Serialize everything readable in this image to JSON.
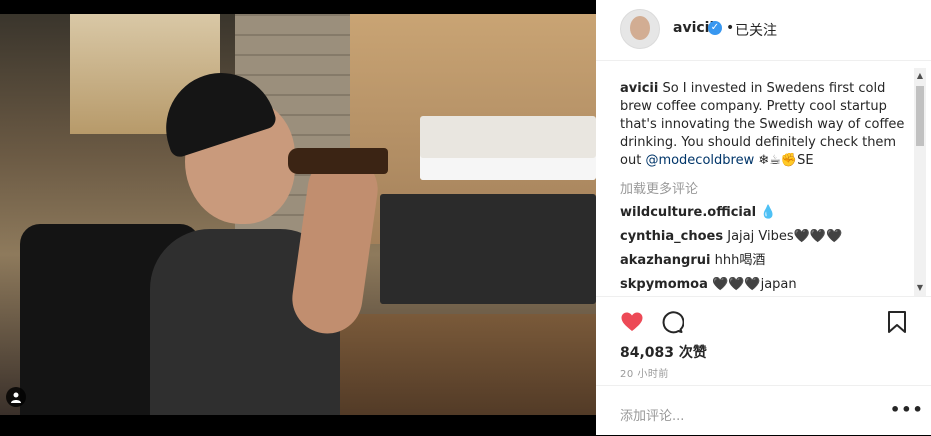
{
  "post": {
    "username": "avicii",
    "follow_status": "已关注",
    "separator": "•",
    "caption_user": "avicii",
    "caption_text": "So I invested in Swedens first cold brew coffee company. Pretty cool startup that's innovating the Swedish way of coffee drinking. You should definitely check them out ",
    "caption_mention": "@modecoldbrew",
    "caption_emoji": " ❄☕✊SE",
    "load_more": "加载更多评论",
    "comments": [
      {
        "user": "wildculture.official",
        "text": "💧"
      },
      {
        "user": "cynthia_choes",
        "text": "Jajaj Vibes🖤🖤🖤"
      },
      {
        "user": "akazhangrui",
        "text": "hhh喝酒"
      },
      {
        "user": "skpymomoa",
        "text": "🖤🖤🖤japan"
      }
    ],
    "likes": "84,083 次赞",
    "time": "20 小时前",
    "add_comment_placeholder": "添加评论...",
    "more_icon_text": "•••"
  },
  "icons": {
    "heart": "heart-icon",
    "comment": "comment-icon",
    "save": "bookmark-icon",
    "verified": "verified-badge-icon",
    "tag": "user-tag-icon"
  },
  "colors": {
    "heart": "#ed4956",
    "verified": "#3897f0",
    "mention": "#003569",
    "muted": "#999999"
  }
}
